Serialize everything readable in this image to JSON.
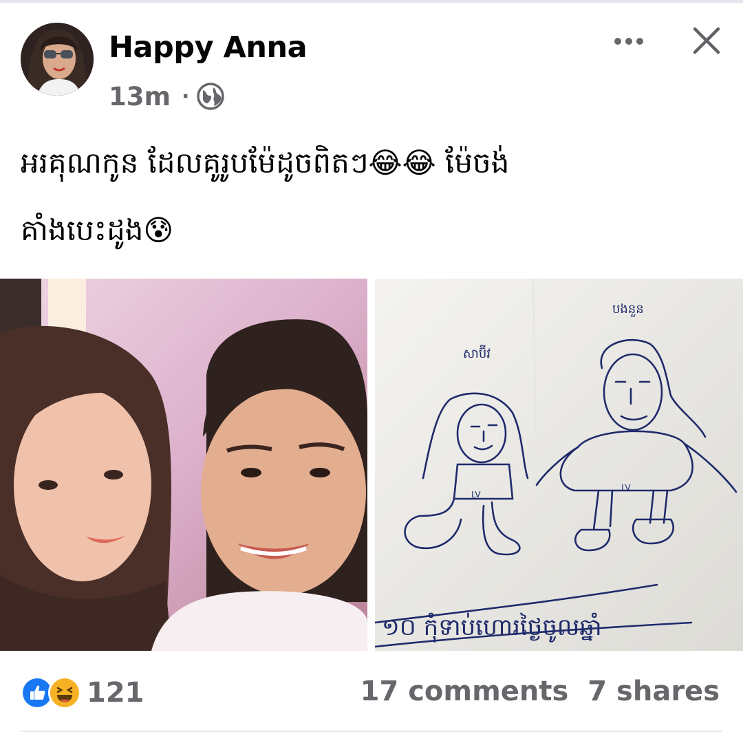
{
  "post": {
    "author": "Happy Anna",
    "time": "13m",
    "separator": "·",
    "privacy_icon": "globe-icon",
    "caption_line1": "អរគុណកូន ដែលគូរូបម៉ែដូចពិតៗ😂😂  ម៉ែចង់",
    "caption_line2": "គាំងបេះដូង😰"
  },
  "header": {
    "more_icon": "more-horizontal-icon",
    "close_icon": "close-icon"
  },
  "drawing": {
    "label_left": "សាប៊ីវ",
    "label_right": "បងនួន",
    "belt_left": "LV",
    "belt_right": "LV",
    "bottom_text": "១០ កុំទាប់ហោរថ្ងៃចូលឆ្នាំ"
  },
  "footer": {
    "reaction_icons": [
      "like-icon",
      "haha-icon"
    ],
    "reaction_count": "121",
    "comments": "17 comments",
    "shares": "7 shares"
  },
  "colors": {
    "like_blue": "#1877f2",
    "haha_yellow": "#f7b125",
    "secondary_text": "#65676b",
    "pen_ink": "#1f2a6b"
  }
}
